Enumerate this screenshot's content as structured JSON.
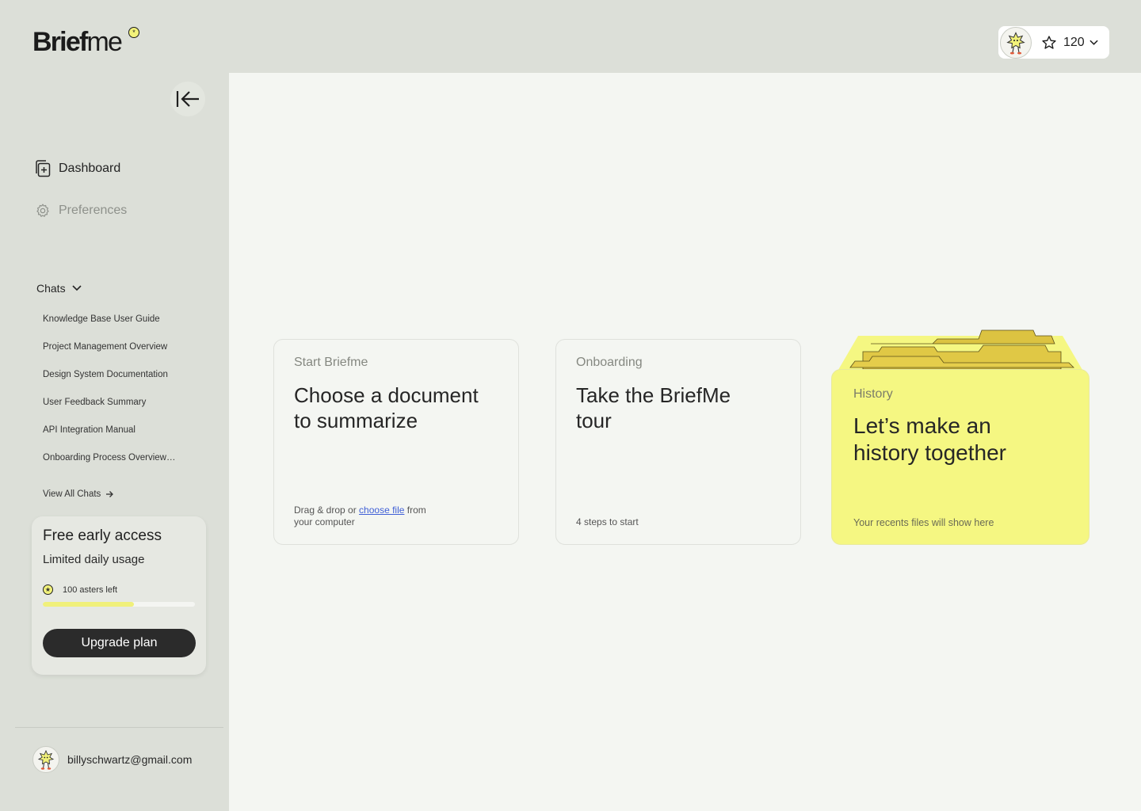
{
  "app": {
    "logo_bold": "Brief",
    "logo_light": "me",
    "logo_star": "*"
  },
  "header": {
    "credits_value": "120",
    "icons": {
      "avatar": "mascot-avatar-icon",
      "credits": "star-outline-icon",
      "dropdown": "chevron-down-icon"
    }
  },
  "sidebar": {
    "nav": [
      {
        "label": "Dashboard",
        "icon": "dashboard-plus-icon",
        "active": true
      },
      {
        "label": "Preferences",
        "icon": "gear-icon",
        "active": false
      }
    ],
    "chats": {
      "header": "Chats",
      "items": [
        "Knowledge Base User Guide",
        "Project Management Overview",
        "Design System Documentation",
        "User Feedback Summary",
        "API Integration Manual",
        "Onboarding Process Overview…"
      ],
      "view_all": "View All Chats"
    },
    "access": {
      "title": "Free early access",
      "subtitle": "Limited daily usage",
      "asters_text": "100 asters left",
      "progress_fraction": 0.6,
      "upgrade_label": "Upgrade plan"
    },
    "user": {
      "email": "billyschwartz@gmail.com"
    }
  },
  "main": {
    "cards": [
      {
        "label": "Start Briefme",
        "title": "Choose a document to summarize",
        "foot_before": "Drag & drop or ",
        "foot_link": "choose file",
        "foot_after": " from your computer"
      },
      {
        "label": "Onboarding",
        "title": "Take the BriefMe tour",
        "foot": "4 steps to start"
      },
      {
        "label": "History",
        "title": "Let’s make an history together",
        "foot": "Your recents files will show here"
      }
    ]
  },
  "colors": {
    "sidebar_bg": "#dcdfd8",
    "main_bg": "#f4f6f2",
    "accent_yellow": "#f5f782",
    "folder_yellow": "#e3c94a",
    "button_dark": "#2b2b2b",
    "link_blue": "#3f5fd6"
  }
}
